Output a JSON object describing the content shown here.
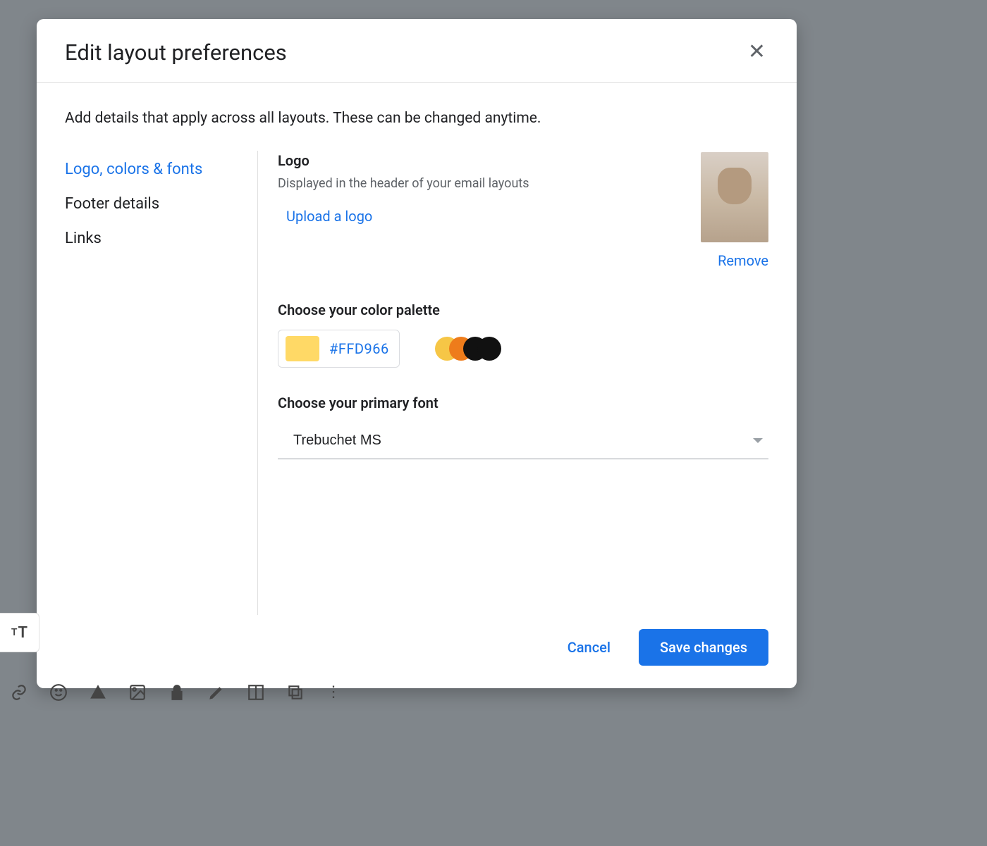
{
  "dialog": {
    "title": "Edit layout preferences",
    "description": "Add details that apply across all layouts. These can be changed anytime.",
    "close_aria": "Close"
  },
  "sidebar": {
    "items": [
      {
        "label": "Logo, colors & fonts",
        "active": true
      },
      {
        "label": "Footer details",
        "active": false
      },
      {
        "label": "Links",
        "active": false
      }
    ]
  },
  "logo_section": {
    "title": "Logo",
    "subtitle": "Displayed in the header of your email layouts",
    "upload_label": "Upload a logo",
    "remove_label": "Remove"
  },
  "palette_section": {
    "title": "Choose your color palette",
    "current_hex": "#FFD966",
    "swatches": [
      "#f6c646",
      "#ee7c1b",
      "#111111",
      "#111111"
    ]
  },
  "font_section": {
    "title": "Choose your primary font",
    "selected": "Trebuchet MS"
  },
  "footer": {
    "cancel": "Cancel",
    "save": "Save changes"
  },
  "bg_chip": {
    "small": "T",
    "big": "T"
  }
}
